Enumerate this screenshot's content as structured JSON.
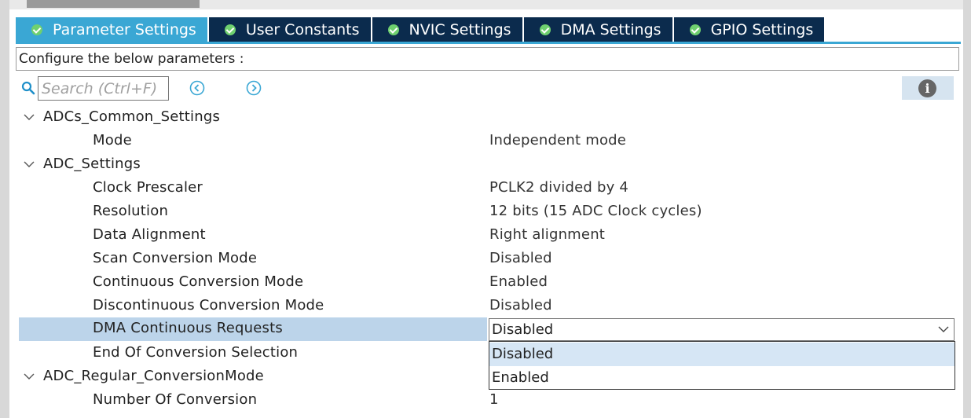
{
  "tabs": [
    {
      "label": "Parameter Settings",
      "active": true
    },
    {
      "label": "User Constants",
      "active": false
    },
    {
      "label": "NVIC Settings",
      "active": false
    },
    {
      "label": "DMA Settings",
      "active": false
    },
    {
      "label": "GPIO Settings",
      "active": false
    }
  ],
  "config_label": "Configure the below parameters :",
  "search": {
    "placeholder": "Search (Ctrl+F)",
    "value": ""
  },
  "icons": {
    "search": "search-icon",
    "prev": "previous-circle-icon",
    "next": "next-circle-icon",
    "info": "info-icon",
    "tab_check": "check-circle-icon",
    "expand": "chevron-down-icon"
  },
  "groups": {
    "common": {
      "label": "ADCs_Common_Settings",
      "params": [
        {
          "name": "Mode",
          "value": "Independent mode"
        }
      ]
    },
    "adc": {
      "label": "ADC_Settings",
      "params": [
        {
          "name": "Clock Prescaler",
          "value": "PCLK2 divided by 4"
        },
        {
          "name": "Resolution",
          "value": "12 bits (15 ADC Clock cycles)"
        },
        {
          "name": "Data Alignment",
          "value": "Right alignment"
        },
        {
          "name": "Scan Conversion Mode",
          "value": "Disabled"
        },
        {
          "name": "Continuous Conversion Mode",
          "value": "Enabled"
        },
        {
          "name": "Discontinuous Conversion Mode",
          "value": "Disabled"
        },
        {
          "name": "DMA Continuous Requests",
          "value": "Disabled"
        },
        {
          "name": "End Of Conversion Selection",
          "value": ""
        }
      ]
    },
    "regular": {
      "label": "ADC_Regular_ConversionMode",
      "params": [
        {
          "name": "Number Of Conversion",
          "value": "1"
        }
      ]
    }
  },
  "dropdown": {
    "selected": "Disabled",
    "options": [
      "Disabled",
      "Enabled"
    ]
  },
  "colors": {
    "tab_active": "#3aa7d4",
    "tab_inactive": "#0b2b4d",
    "check": "#6fd06f",
    "row_selected": "#bcd4ea",
    "option_highlight": "#d6e6f5"
  }
}
